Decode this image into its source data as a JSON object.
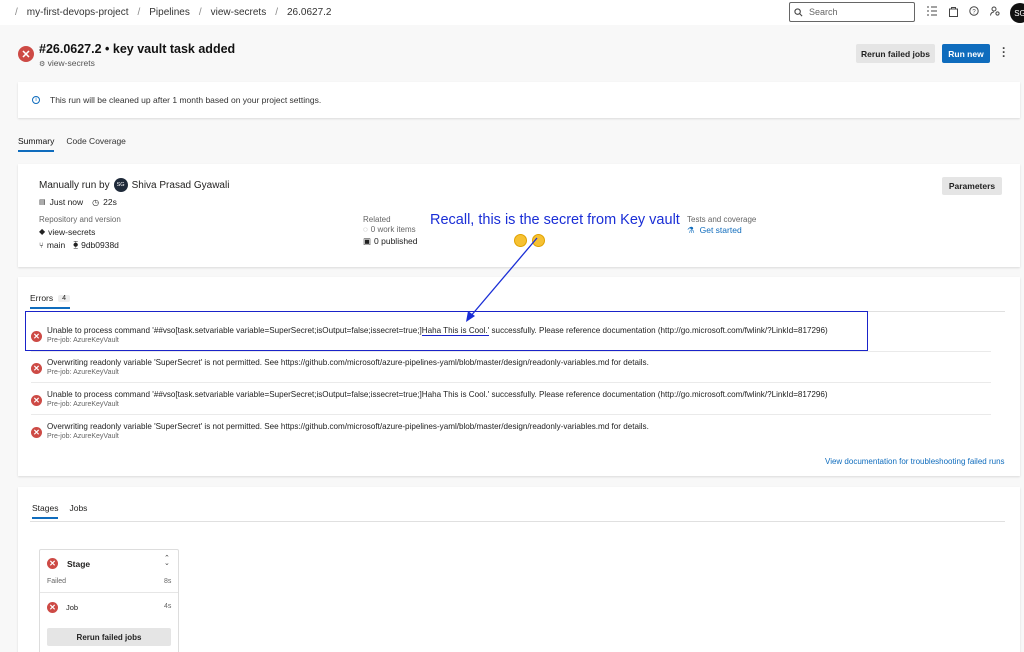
{
  "breadcrumb": [
    "my-first-devops-project",
    "Pipelines",
    "view-secrets",
    "26.0627.2"
  ],
  "search": {
    "placeholder": "Search"
  },
  "user_initials": "SG",
  "run": {
    "title": "#26.0627.2 • key vault task added",
    "pipeline": "view-secrets",
    "rerun_label": "Rerun failed jobs",
    "run_new_label": "Run new"
  },
  "info_banner": "This run will be cleaned up after 1 month based on your project settings.",
  "tabs": [
    "Summary",
    "Code Coverage"
  ],
  "summary": {
    "manual_prefix": "Manually run by",
    "user_initials": "SG",
    "user_name": "Shiva Prasad Gyawali",
    "time": "Just now",
    "duration": "22s",
    "parameters_label": "Parameters",
    "repo_label": "Repository and version",
    "repo_name": "view-secrets",
    "branch": "main",
    "commit": "9db0938d",
    "related_label": "Related",
    "work_items": "0 work items",
    "published": "0 published",
    "tests_label": "Tests and coverage",
    "get_started": "Get started"
  },
  "errors": {
    "tab_label": "Errors",
    "count": "4",
    "items": [
      {
        "before": "Unable to process command '##vso[task.setvariable variable=SuperSecret;isOutput=false;issecret=true;]",
        "secret": "Haha This is Cool.'",
        "after": " successfully. Please reference documentation (http://go.microsoft.com/fwlink/?LinkId=817296)",
        "source": "Pre-job: AzureKeyVault"
      },
      {
        "message": "Overwriting readonly variable 'SuperSecret' is not permitted. See https://github.com/microsoft/azure-pipelines-yaml/blob/master/design/readonly-variables.md for details.",
        "source": "Pre-job: AzureKeyVault"
      },
      {
        "message": "Unable to process command '##vso[task.setvariable variable=SuperSecret;isOutput=false;issecret=true;]Haha This is Cool.' successfully. Please reference documentation (http://go.microsoft.com/fwlink/?LinkId=817296)",
        "source": "Pre-job: AzureKeyVault"
      },
      {
        "message": "Overwriting readonly variable 'SuperSecret' is not permitted. See https://github.com/microsoft/azure-pipelines-yaml/blob/master/design/readonly-variables.md for details.",
        "source": "Pre-job: AzureKeyVault"
      }
    ],
    "doc_link": "View documentation for troubleshooting failed runs"
  },
  "stages_section": {
    "tabs": [
      "Stages",
      "Jobs"
    ],
    "stage_name": "Stage",
    "stage_status": "Failed",
    "stage_duration": "8s",
    "job_name": "Job",
    "job_duration": "4s",
    "rerun_label": "Rerun failed jobs"
  },
  "annotation": {
    "text": "Recall, this is the secret from Key vault",
    "color": "#1a2ed6"
  },
  "colors": {
    "error": "#cd4a45",
    "accent": "#0f6cbd"
  }
}
